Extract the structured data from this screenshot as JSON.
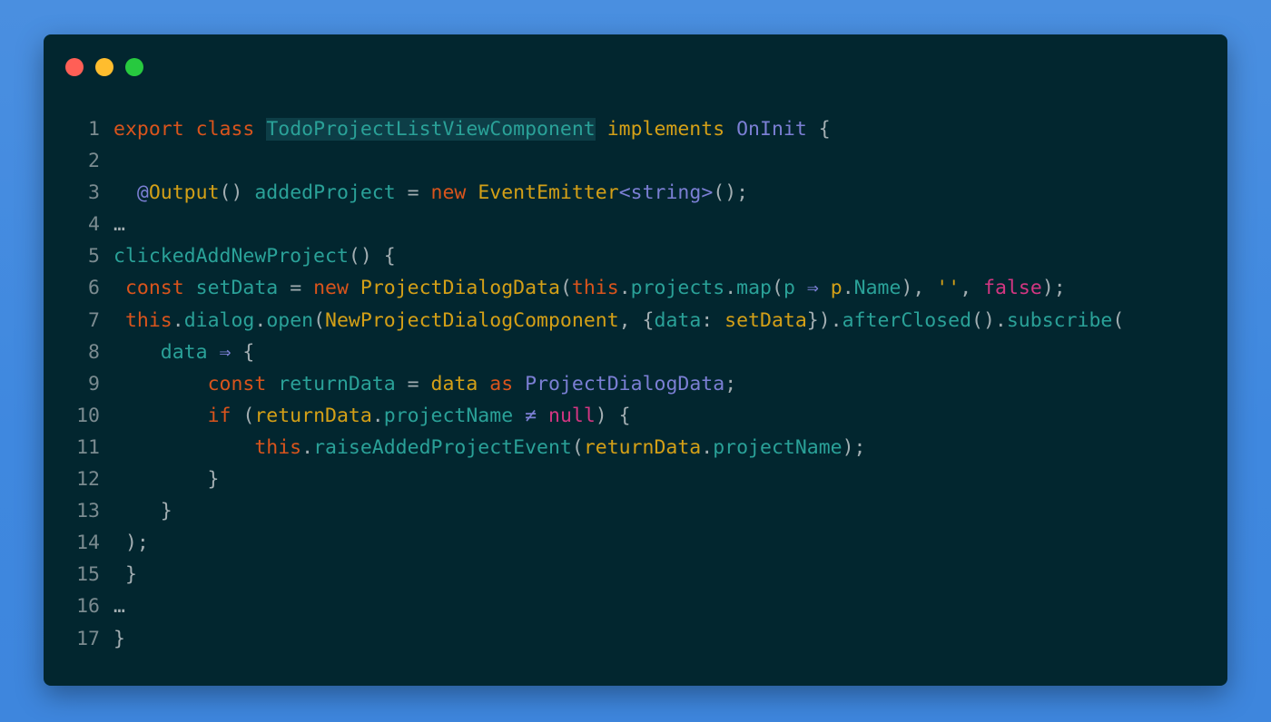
{
  "window": {
    "background": "#02262f",
    "dots": [
      {
        "name": "close-dot",
        "color": "#ff5f56"
      },
      {
        "name": "minimize-dot",
        "color": "#ffbd2e"
      },
      {
        "name": "maximize-dot",
        "color": "#27c93f"
      }
    ]
  },
  "colors": {
    "keyword": "#d9541c",
    "type": "#7b7fd4",
    "ident": "#2aa198",
    "orange": "#d4a017",
    "punct": "#a3aeb2",
    "literal": "#d33682",
    "comment": "#7b8b90"
  },
  "lines": [
    {
      "n": "1",
      "tokens": [
        {
          "t": "export",
          "c": "keyword"
        },
        {
          "t": " ",
          "c": "punct"
        },
        {
          "t": "class",
          "c": "keyword"
        },
        {
          "t": " ",
          "c": "punct"
        },
        {
          "t": "TodoProjectListViewComponent",
          "c": "ident",
          "hl": true
        },
        {
          "t": " ",
          "c": "punct"
        },
        {
          "t": "implements",
          "c": "orange"
        },
        {
          "t": " ",
          "c": "punct"
        },
        {
          "t": "OnInit",
          "c": "type"
        },
        {
          "t": " {",
          "c": "punct"
        }
      ]
    },
    {
      "n": "2",
      "tokens": []
    },
    {
      "n": "3",
      "tokens": [
        {
          "t": "  ",
          "c": "punct"
        },
        {
          "t": "@",
          "c": "type"
        },
        {
          "t": "Output",
          "c": "orange"
        },
        {
          "t": "() ",
          "c": "punct"
        },
        {
          "t": "addedProject",
          "c": "ident"
        },
        {
          "t": " = ",
          "c": "punct"
        },
        {
          "t": "new",
          "c": "keyword"
        },
        {
          "t": " ",
          "c": "punct"
        },
        {
          "t": "EventEmitter",
          "c": "orange"
        },
        {
          "t": "<",
          "c": "type"
        },
        {
          "t": "string",
          "c": "type"
        },
        {
          "t": ">",
          "c": "type"
        },
        {
          "t": "();",
          "c": "punct"
        }
      ]
    },
    {
      "n": "4",
      "tokens": [
        {
          "t": "…",
          "c": "punct"
        }
      ]
    },
    {
      "n": "5",
      "tokens": [
        {
          "t": "clickedAddNewProject",
          "c": "ident"
        },
        {
          "t": "() {",
          "c": "punct"
        }
      ]
    },
    {
      "n": "6",
      "tokens": [
        {
          "t": " ",
          "c": "punct"
        },
        {
          "t": "const",
          "c": "keyword"
        },
        {
          "t": " ",
          "c": "punct"
        },
        {
          "t": "setData",
          "c": "ident"
        },
        {
          "t": " = ",
          "c": "punct"
        },
        {
          "t": "new",
          "c": "keyword"
        },
        {
          "t": " ",
          "c": "punct"
        },
        {
          "t": "ProjectDialogData",
          "c": "orange"
        },
        {
          "t": "(",
          "c": "punct"
        },
        {
          "t": "this",
          "c": "keyword"
        },
        {
          "t": ".",
          "c": "punct"
        },
        {
          "t": "projects",
          "c": "ident"
        },
        {
          "t": ".",
          "c": "punct"
        },
        {
          "t": "map",
          "c": "ident"
        },
        {
          "t": "(",
          "c": "punct"
        },
        {
          "t": "p",
          "c": "ident"
        },
        {
          "t": " ",
          "c": "punct"
        },
        {
          "t": "⇒",
          "c": "type"
        },
        {
          "t": " ",
          "c": "punct"
        },
        {
          "t": "p",
          "c": "orange"
        },
        {
          "t": ".",
          "c": "punct"
        },
        {
          "t": "Name",
          "c": "ident"
        },
        {
          "t": "), ",
          "c": "punct"
        },
        {
          "t": "''",
          "c": "orange"
        },
        {
          "t": ", ",
          "c": "punct"
        },
        {
          "t": "false",
          "c": "literal"
        },
        {
          "t": ");",
          "c": "punct"
        }
      ]
    },
    {
      "n": "7",
      "tokens": [
        {
          "t": " ",
          "c": "punct"
        },
        {
          "t": "this",
          "c": "keyword"
        },
        {
          "t": ".",
          "c": "punct"
        },
        {
          "t": "dialog",
          "c": "ident"
        },
        {
          "t": ".",
          "c": "punct"
        },
        {
          "t": "open",
          "c": "ident"
        },
        {
          "t": "(",
          "c": "punct"
        },
        {
          "t": "NewProjectDialogComponent",
          "c": "orange"
        },
        {
          "t": ", {",
          "c": "punct"
        },
        {
          "t": "data",
          "c": "ident"
        },
        {
          "t": ": ",
          "c": "punct"
        },
        {
          "t": "setData",
          "c": "orange"
        },
        {
          "t": "}).",
          "c": "punct"
        },
        {
          "t": "afterClosed",
          "c": "ident"
        },
        {
          "t": "().",
          "c": "punct"
        },
        {
          "t": "subscribe",
          "c": "ident"
        },
        {
          "t": "(",
          "c": "punct"
        }
      ]
    },
    {
      "n": "8",
      "tokens": [
        {
          "t": "    ",
          "c": "punct"
        },
        {
          "t": "data",
          "c": "ident"
        },
        {
          "t": " ",
          "c": "punct"
        },
        {
          "t": "⇒",
          "c": "type"
        },
        {
          "t": " {",
          "c": "punct"
        }
      ]
    },
    {
      "n": "9",
      "tokens": [
        {
          "t": "        ",
          "c": "punct"
        },
        {
          "t": "const",
          "c": "keyword"
        },
        {
          "t": " ",
          "c": "punct"
        },
        {
          "t": "returnData",
          "c": "ident"
        },
        {
          "t": " = ",
          "c": "punct"
        },
        {
          "t": "data",
          "c": "orange"
        },
        {
          "t": " ",
          "c": "punct"
        },
        {
          "t": "as",
          "c": "keyword"
        },
        {
          "t": " ",
          "c": "punct"
        },
        {
          "t": "ProjectDialogData",
          "c": "type"
        },
        {
          "t": ";",
          "c": "punct"
        }
      ]
    },
    {
      "n": "10",
      "tokens": [
        {
          "t": "        ",
          "c": "punct"
        },
        {
          "t": "if",
          "c": "keyword"
        },
        {
          "t": " (",
          "c": "punct"
        },
        {
          "t": "returnData",
          "c": "orange"
        },
        {
          "t": ".",
          "c": "punct"
        },
        {
          "t": "projectName",
          "c": "ident"
        },
        {
          "t": " ",
          "c": "punct"
        },
        {
          "t": "≠",
          "c": "type"
        },
        {
          "t": " ",
          "c": "punct"
        },
        {
          "t": "null",
          "c": "literal"
        },
        {
          "t": ") {",
          "c": "punct"
        }
      ]
    },
    {
      "n": "11",
      "tokens": [
        {
          "t": "            ",
          "c": "punct"
        },
        {
          "t": "this",
          "c": "keyword"
        },
        {
          "t": ".",
          "c": "punct"
        },
        {
          "t": "raiseAddedProjectEvent",
          "c": "ident"
        },
        {
          "t": "(",
          "c": "punct"
        },
        {
          "t": "returnData",
          "c": "orange"
        },
        {
          "t": ".",
          "c": "punct"
        },
        {
          "t": "projectName",
          "c": "ident"
        },
        {
          "t": ");",
          "c": "punct"
        }
      ]
    },
    {
      "n": "12",
      "tokens": [
        {
          "t": "        }",
          "c": "punct"
        }
      ]
    },
    {
      "n": "13",
      "tokens": [
        {
          "t": "    }",
          "c": "punct"
        }
      ]
    },
    {
      "n": "14",
      "tokens": [
        {
          "t": " );",
          "c": "punct"
        }
      ]
    },
    {
      "n": "15",
      "tokens": [
        {
          "t": " }",
          "c": "punct"
        }
      ]
    },
    {
      "n": "16",
      "tokens": [
        {
          "t": "…",
          "c": "punct"
        }
      ]
    },
    {
      "n": "17",
      "tokens": [
        {
          "t": "}",
          "c": "punct"
        }
      ]
    }
  ]
}
